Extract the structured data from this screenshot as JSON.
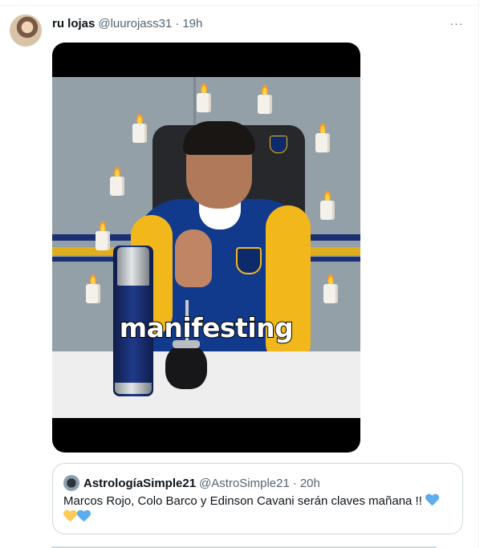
{
  "tweet": {
    "author_name": "ru lojas",
    "author_handle": "@luurojass31",
    "separator": "·",
    "time": "19h",
    "more_icon": "···",
    "media": {
      "caption": "manifesting"
    }
  },
  "quoted_tweet": {
    "author_name": "AstrologíaSimple21",
    "author_handle": "@AstroSimple21",
    "separator": "·",
    "time": "20h",
    "text": "Marcos Rojo, Colo Barco y Edinson Cavani serán claves mañana !!",
    "heart_colors": [
      "#5dadec",
      "#fdcb58",
      "#5dadec"
    ]
  }
}
